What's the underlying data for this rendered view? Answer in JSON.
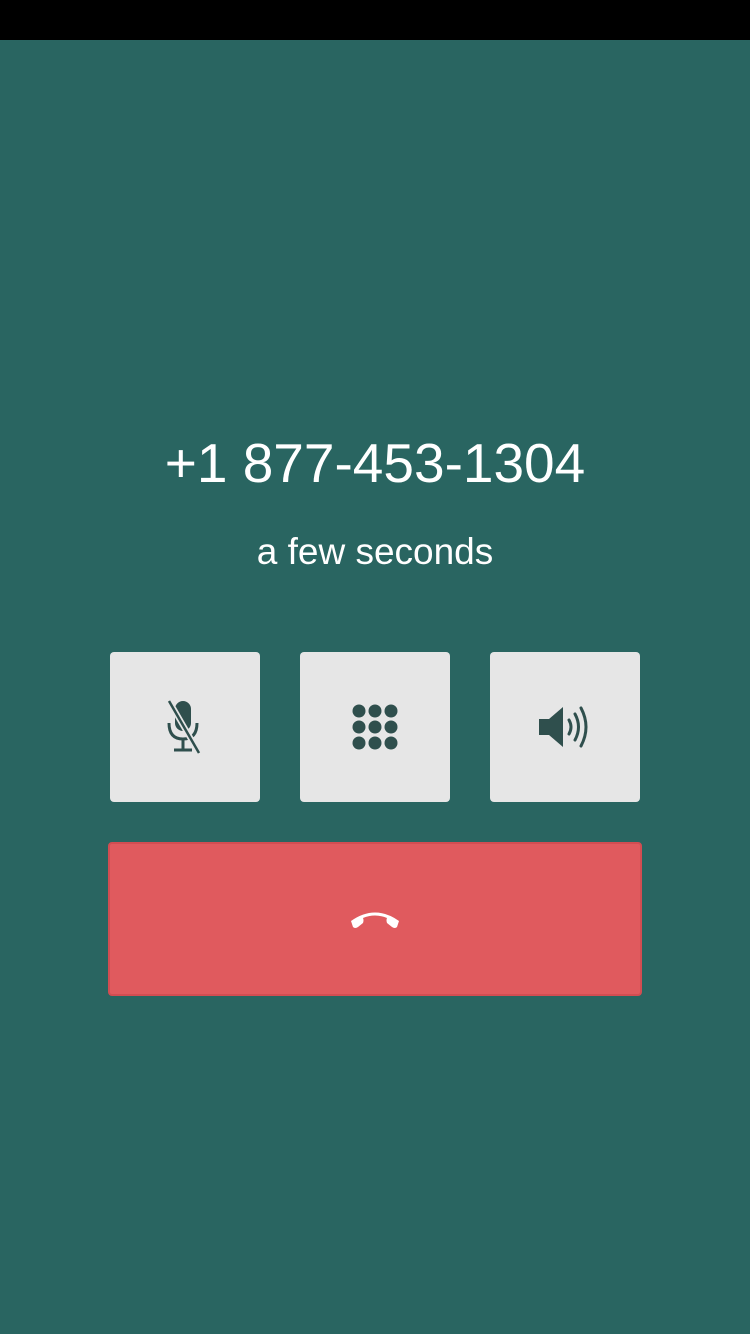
{
  "status_bar": {
    "color": "#000000"
  },
  "call": {
    "number": "+1 877-453-1304",
    "duration": "a few seconds"
  },
  "controls": {
    "mute": {
      "icon": "microphone-muted-icon"
    },
    "keypad": {
      "icon": "dialpad-icon"
    },
    "speaker": {
      "icon": "speaker-volume-icon"
    }
  },
  "hangup": {
    "icon": "phone-hangup-icon",
    "color": "#e05a5e"
  },
  "colors": {
    "background": "#296561",
    "control_button": "#e6e6e6",
    "icon": "#2f4f4d",
    "text": "#ffffff"
  }
}
